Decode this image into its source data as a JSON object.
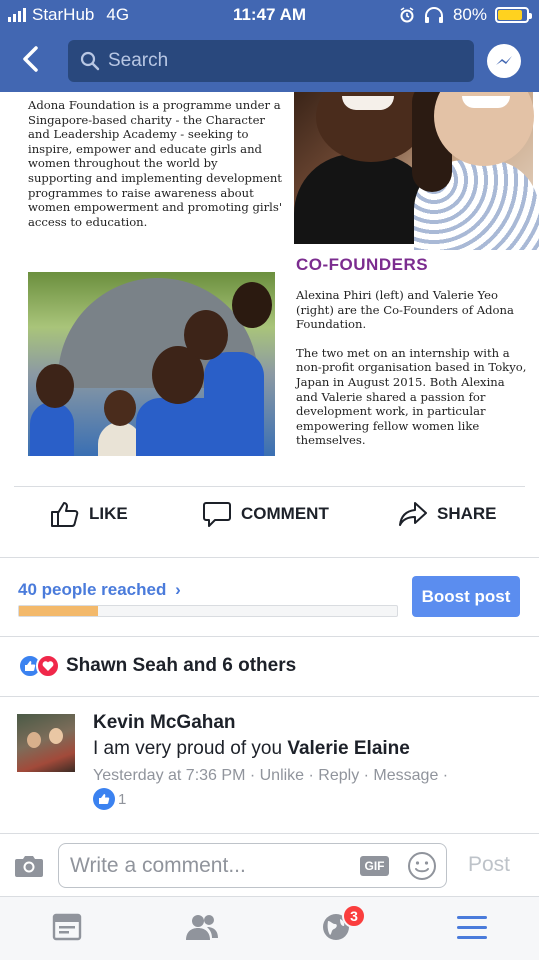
{
  "status_bar": {
    "carrier": "StarHub",
    "network": "4G",
    "time": "11:47 AM",
    "battery_percent": "80%",
    "battery_level": 0.8
  },
  "header": {
    "search_placeholder": "Search",
    "back_icon": "chevron-left-icon",
    "messenger_icon": "messenger-icon"
  },
  "flyer": {
    "about": "Adona Foundation is a programme under a Singapore-based charity - the Character and Leadership Academy - seeking to inspire, empower and educate girls and women throughout the world by supporting and implementing development programmes to raise awareness about women empowerment and promoting girls' access to education.",
    "heading": "CO-FOUNDERS",
    "bio_1": "Alexina Phiri (left) and Valerie Yeo (right) are the Co-Founders of Adona Foundation.",
    "bio_2": "The two met on an internship with a non-profit organisation based in Tokyo, Japan in August 2015.  Both Alexina and Valerie shared a passion for development work, in particular empowering fellow women like themselves.",
    "heading_color": "#7b2c8f"
  },
  "actions": {
    "like": "LIKE",
    "comment": "COMMENT",
    "share": "SHARE"
  },
  "insights": {
    "reached": "40 people reached",
    "progress_fraction": 0.21,
    "boost_label": "Boost post",
    "boost_color": "#5b8def"
  },
  "reactions": {
    "summary": "Shawn Seah and 6 others"
  },
  "comment": {
    "author": "Kevin McGahan",
    "text_prefix": "I am very proud of you ",
    "mention": "Valerie Elaine",
    "timestamp": "Yesterday at 7:36 PM",
    "unlike": "Unlike",
    "reply": "Reply",
    "message": "Message",
    "like_count": "1"
  },
  "composer": {
    "placeholder": "Write a comment...",
    "gif": "GIF",
    "post": "Post"
  },
  "tabbar": {
    "notifications_badge": "3",
    "accent": "#4a7bdb"
  }
}
